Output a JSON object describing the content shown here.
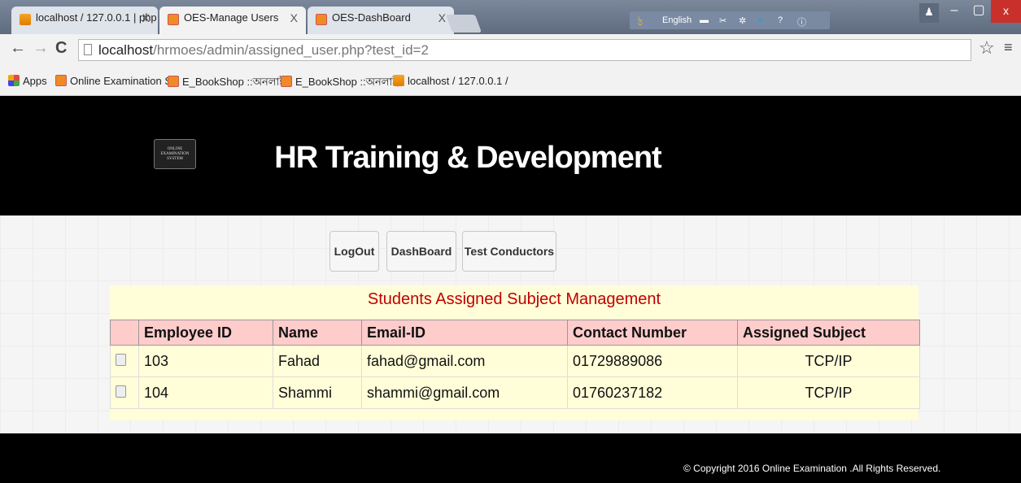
{
  "browser": {
    "tabs": [
      {
        "title": "localhost / 127.0.0.1 | php",
        "favicon": "pma-icon",
        "close": "X"
      },
      {
        "title": "OES-Manage Users",
        "favicon": "oes-icon",
        "close": "X"
      },
      {
        "title": "OES-DashBoard",
        "favicon": "oes-icon",
        "close": "X"
      }
    ],
    "ime_label": "English",
    "url_host": "localhost",
    "url_path": "/hrmoes/admin/assigned_user.php?test_id=2",
    "bookmarks": [
      {
        "label": "Apps"
      },
      {
        "label": "Online Examination S"
      },
      {
        "label": "E_BookShop ::অনলাই"
      },
      {
        "label": "E_BookShop ::অনলাই"
      },
      {
        "label": "localhost / 127.0.0.1 /"
      }
    ]
  },
  "header": {
    "logo_text": "ONLINE EXAMINATION SYSTEM",
    "title": "HR Training & Development"
  },
  "nav": {
    "logout": "LogOut",
    "dashboard": "DashBoard",
    "test_conductors": "Test Conductors"
  },
  "panel": {
    "title": "Students Assigned Subject Management",
    "columns": [
      "Employee ID",
      "Name",
      "Email-ID",
      "Contact Number",
      "Assigned Subject"
    ],
    "rows": [
      {
        "id": "103",
        "name": "Fahad",
        "email": "fahad@gmail.com",
        "contact": "01729889086",
        "subject": "TCP/IP"
      },
      {
        "id": "104",
        "name": "Shammi",
        "email": "shammi@gmail.com",
        "contact": "01760237182",
        "subject": "TCP/IP"
      }
    ]
  },
  "footer": {
    "copyright": "© Copyright 2016 Online Examination .All Rights Reserved."
  }
}
